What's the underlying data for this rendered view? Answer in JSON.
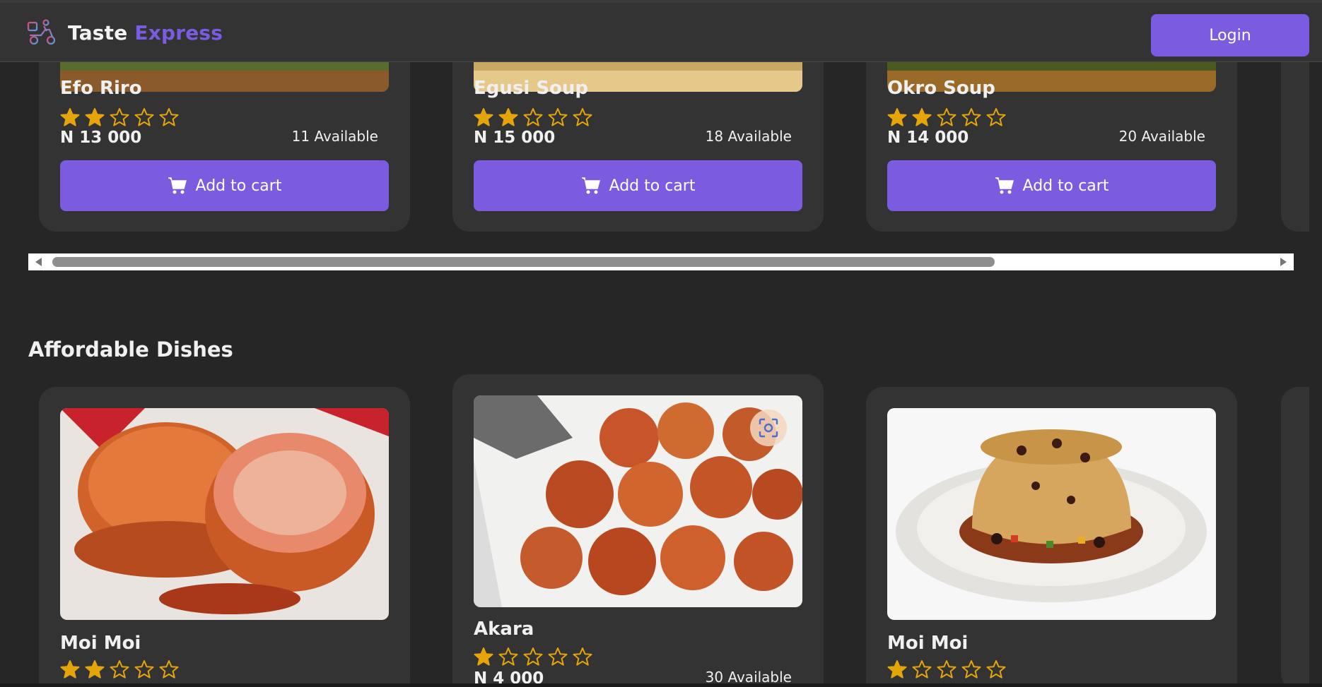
{
  "brand": {
    "name_part1": "Taste",
    "name_part2": "Express",
    "accent_color": "#7b5ce0"
  },
  "header": {
    "login_label": "Login"
  },
  "top_row": [
    {
      "title": "Efo Riro",
      "rating": 2,
      "price": "N 13 000",
      "available": "11 Available",
      "cart_label": "Add to cart"
    },
    {
      "title": "Egusi Soup",
      "rating": 2,
      "price": "N 15 000",
      "available": "18 Available",
      "cart_label": "Add to cart"
    },
    {
      "title": "Okro Soup",
      "rating": 2,
      "price": "N 14 000",
      "available": "20 Available",
      "cart_label": "Add to cart"
    }
  ],
  "scrollbar": {
    "thumb_fraction": 0.745
  },
  "section": {
    "title": "Affordable Dishes"
  },
  "affordable": [
    {
      "title": "Moi Moi",
      "rating": 2,
      "image": "moi-moi-slices"
    },
    {
      "title": "Akara",
      "rating": 1,
      "price": "N 4 000",
      "available": "30 Available",
      "image": "akara-fritters"
    },
    {
      "title": "Moi Moi",
      "rating": 1,
      "image": "moi-moi-plate"
    }
  ],
  "colors": {
    "star": "#e5a50a",
    "card_bg": "#333333",
    "page_bg": "#262626",
    "button": "#7b5ce0"
  }
}
